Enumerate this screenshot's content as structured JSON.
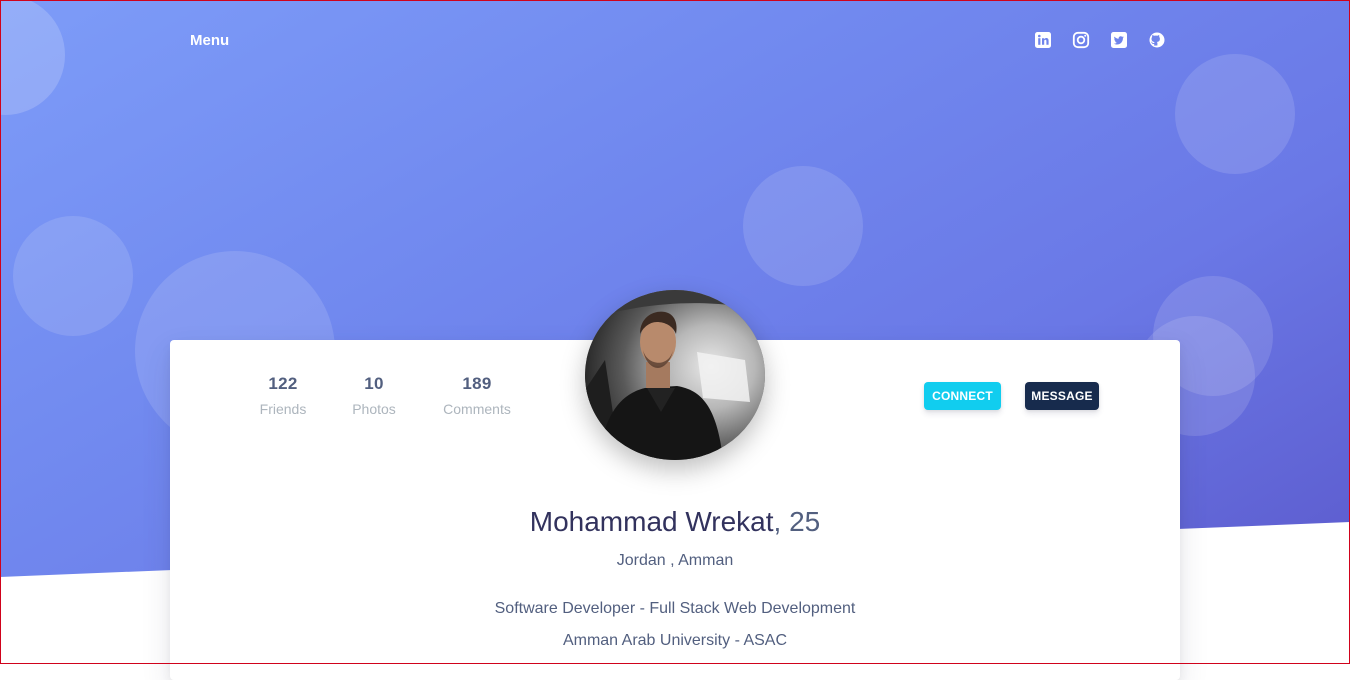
{
  "nav": {
    "menu_label": "Menu",
    "social": [
      {
        "icon": "linkedin-icon"
      },
      {
        "icon": "instagram-icon"
      },
      {
        "icon": "twitter-icon"
      },
      {
        "icon": "github-icon"
      }
    ]
  },
  "colors": {
    "hero_gradient_start": "#7d9cf8",
    "hero_gradient_end": "#5a56c9",
    "connect_button": "#11cdef",
    "message_button": "#172b4d",
    "heading_text": "#32325d",
    "body_text": "#525f7f",
    "muted_text": "#adb5bd"
  },
  "profile": {
    "stats": [
      {
        "value": "122",
        "label": "Friends"
      },
      {
        "value": "10",
        "label": "Photos"
      },
      {
        "value": "189",
        "label": "Comments"
      }
    ],
    "connect_label": "Connect",
    "message_label": "Message",
    "name": "Mohammad Wrekat",
    "age": ", 25",
    "location": "Jordan , Amman",
    "title": "Software Developer - Full Stack Web Development",
    "education": "Amman Arab University - ASAC"
  }
}
